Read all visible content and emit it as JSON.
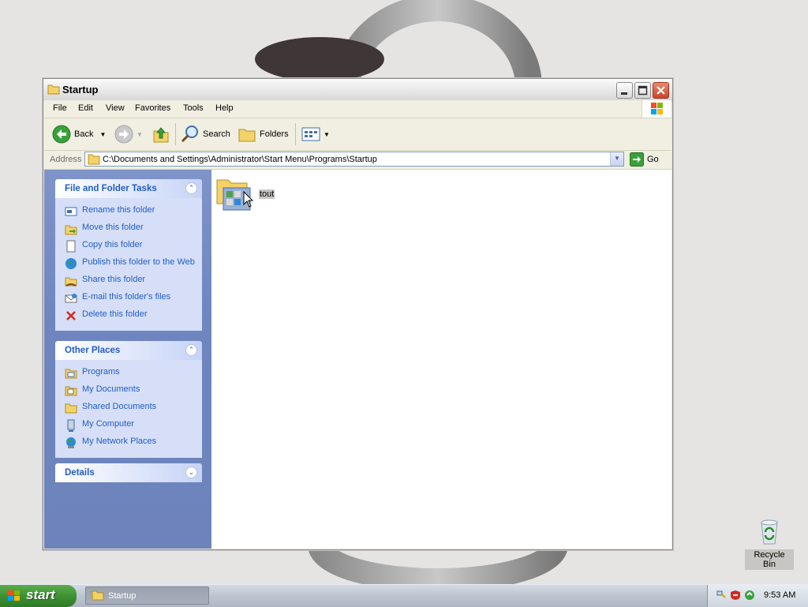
{
  "window": {
    "title": "Startup",
    "menu": [
      "File",
      "Edit",
      "View",
      "Favorites",
      "Tools",
      "Help"
    ],
    "toolbar": {
      "back": "Back",
      "search": "Search",
      "folders": "Folders"
    },
    "address": {
      "label": "Address",
      "value": "C:\\Documents and Settings\\Administrator\\Start Menu\\Programs\\Startup",
      "go": "Go"
    }
  },
  "tasks_panel": {
    "title": "File and Folder Tasks",
    "items": [
      {
        "label": "Rename this folder",
        "icon": "rename-icon"
      },
      {
        "label": "Move this folder",
        "icon": "move-icon"
      },
      {
        "label": "Copy this folder",
        "icon": "copy-icon"
      },
      {
        "label": "Publish this folder to the Web",
        "icon": "publish-web-icon"
      },
      {
        "label": "Share this folder",
        "icon": "share-icon"
      },
      {
        "label": "E-mail this folder's files",
        "icon": "email-icon"
      },
      {
        "label": "Delete this folder",
        "icon": "delete-icon"
      }
    ]
  },
  "places_panel": {
    "title": "Other Places",
    "items": [
      {
        "label": "Programs",
        "icon": "programs-icon"
      },
      {
        "label": "My Documents",
        "icon": "my-documents-icon"
      },
      {
        "label": "Shared Documents",
        "icon": "shared-documents-icon"
      },
      {
        "label": "My Computer",
        "icon": "my-computer-icon"
      },
      {
        "label": "My Network Places",
        "icon": "network-places-icon"
      }
    ]
  },
  "details_panel": {
    "title": "Details"
  },
  "content": {
    "items": [
      {
        "name": "tout",
        "icon": "shortcut-folder-icon"
      }
    ]
  },
  "desktop": {
    "recycle_bin": "Recycle Bin"
  },
  "taskbar": {
    "start": "start",
    "task": "Startup",
    "clock": "9:53 AM"
  }
}
